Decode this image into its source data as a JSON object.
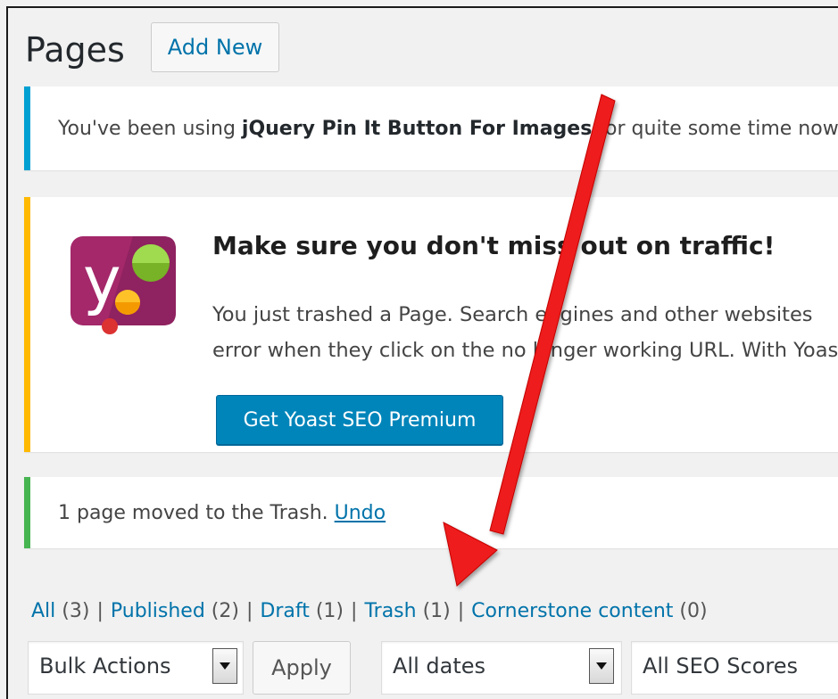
{
  "header": {
    "title": "Pages",
    "add_new_label": "Add New"
  },
  "notices": {
    "info": {
      "prefix": "You've been using ",
      "plugin_name": "jQuery Pin It Button For Images",
      "suffix": " for quite some time now"
    },
    "yoast": {
      "heading": "Make sure you don't miss out on traffic!",
      "line1": "You just trashed a Page. Search engines and other websites",
      "line2": "error when they click on the no longer working URL. With Yoast",
      "button_label": "Get Yoast SEO Premium"
    },
    "success": {
      "message": "1 page moved to the Trash. ",
      "undo_label": "Undo"
    }
  },
  "filters": {
    "views": [
      {
        "label": "All",
        "count": "(3)"
      },
      {
        "label": "Published",
        "count": "(2)"
      },
      {
        "label": "Draft",
        "count": "(1)"
      },
      {
        "label": "Trash",
        "count": "(1)"
      },
      {
        "label": "Cornerstone content",
        "count": " (0)"
      }
    ],
    "separator": "|"
  },
  "tablenav": {
    "bulk_actions": "Bulk Actions",
    "apply_label": "Apply",
    "dates": "All dates",
    "seo_scores": "All SEO Scores"
  },
  "colors": {
    "link": "#0073aa",
    "info_border": "#00a0d2",
    "warning_border": "#ffb900",
    "success_border": "#46b450",
    "yoast_button": "#0085ba",
    "annotation_arrow": "#ee1c1c"
  },
  "icons": {
    "yoast": "yoast-logo-icon",
    "dropdown": "dropdown-arrow-icon",
    "annotation": "red-arrow-annotation"
  }
}
